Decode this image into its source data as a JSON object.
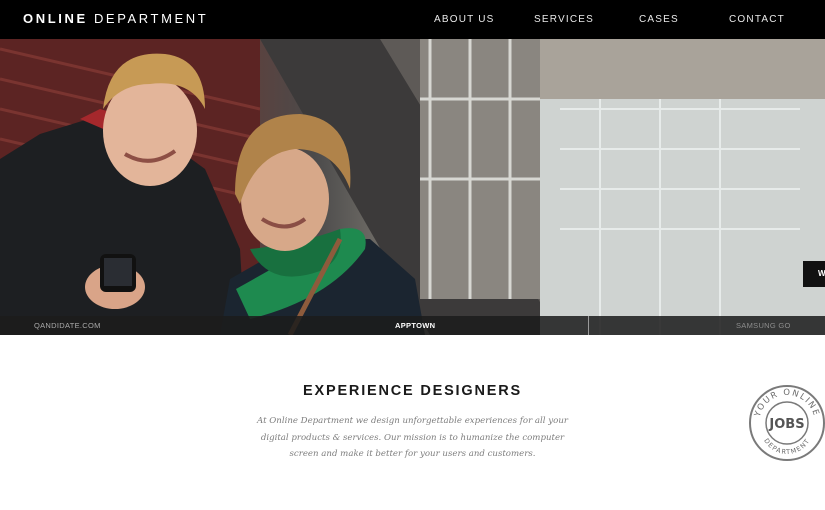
{
  "brand": {
    "logo_strong": "ONLINE",
    "logo_light": "DEPARTMENT"
  },
  "nav": {
    "items": [
      {
        "label": "ABOUT US"
      },
      {
        "label": "SERVICES"
      },
      {
        "label": "CASES"
      },
      {
        "label": "CONTACT"
      }
    ]
  },
  "hero": {
    "slides": [
      {
        "label": "QANDIDATE.COM",
        "active": false
      },
      {
        "label": "APPTOWN",
        "active": true
      },
      {
        "label": "SAMSUNG GO",
        "active": false
      }
    ],
    "side_tab_label": "W"
  },
  "intro": {
    "headline": "EXPERIENCE DESIGNERS",
    "lines": [
      "At Online Department we design unforgettable experiences for all your",
      "digital products & services. Our mission is to humanize the computer",
      "screen and make it better for your users and customers."
    ]
  },
  "jobs_badge": {
    "center_text": "JOBS",
    "ring_top": "YOUR ONLINE",
    "ring_bottom": "DEPARTMENT"
  },
  "colors": {
    "nav_bg": "#000000",
    "accent_scarf": "#1e8a4f"
  }
}
